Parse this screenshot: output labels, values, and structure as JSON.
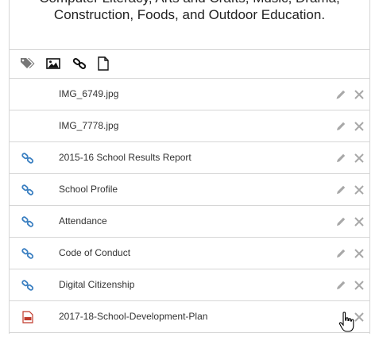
{
  "description": {
    "line1": "Computer Literacy, Arts and Crafts, Music, Drama,",
    "line2": "Construction, Foods, and Outdoor Education."
  },
  "toolbar": {
    "icons": [
      "tags-icon",
      "image-icon",
      "link-icon",
      "document-icon"
    ]
  },
  "items": [
    {
      "type": "image",
      "label": "IMG_6749.jpg"
    },
    {
      "type": "image",
      "label": "IMG_7778.jpg"
    },
    {
      "type": "link",
      "label": "2015-16 School Results Report"
    },
    {
      "type": "link",
      "label": "School Profile"
    },
    {
      "type": "link",
      "label": "Attendance"
    },
    {
      "type": "link",
      "label": "Code of Conduct"
    },
    {
      "type": "link",
      "label": "Digital Citizenship"
    },
    {
      "type": "pdf",
      "label": "2017-18-School-Development-Plan"
    }
  ],
  "colors": {
    "link_icon": "#3a7fc1",
    "pdf_icon": "#c0392b",
    "action_icon": "#a8a8a8",
    "border": "#d6d6d6"
  }
}
